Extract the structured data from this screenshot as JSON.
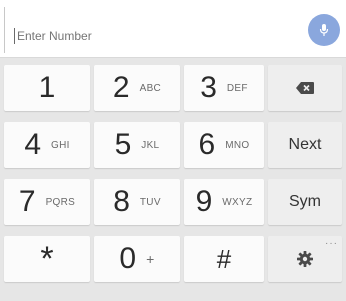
{
  "input": {
    "placeholder": "Enter Number"
  },
  "keys": {
    "k1": {
      "digit": "1",
      "letters": ""
    },
    "k2": {
      "digit": "2",
      "letters": "ABC"
    },
    "k3": {
      "digit": "3",
      "letters": "DEF"
    },
    "k4": {
      "digit": "4",
      "letters": "GHI"
    },
    "k5": {
      "digit": "5",
      "letters": "JKL"
    },
    "k6": {
      "digit": "6",
      "letters": "MNO"
    },
    "k7": {
      "digit": "7",
      "letters": "PQRS"
    },
    "k8": {
      "digit": "8",
      "letters": "TUV"
    },
    "k9": {
      "digit": "9",
      "letters": "WXYZ"
    },
    "star": {
      "digit": "*"
    },
    "k0": {
      "digit": "0",
      "letters": "+"
    },
    "hash": {
      "digit": "#"
    }
  },
  "fn": {
    "next": "Next",
    "sym": "Sym",
    "more": "···"
  },
  "icons": {
    "mic": "microphone-icon",
    "backspace": "backspace-icon",
    "settings": "settings-gear-icon"
  },
  "colors": {
    "mic_bg": "#8aa7dd",
    "key_bg": "#fbfbfb",
    "fn_key_bg": "#eeeeee",
    "pad_bg": "#e6e6e6"
  }
}
